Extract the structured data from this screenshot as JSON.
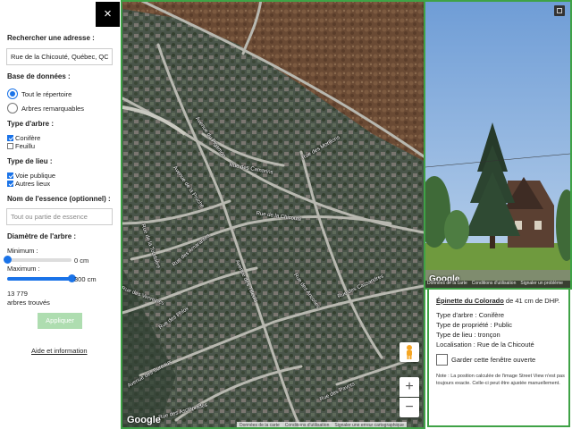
{
  "sidebar": {
    "close_label": "×",
    "search_title": "Rechercher une adresse :",
    "search_value": "Rue de la Chicouté, Québec, QC,",
    "database_title": "Base de données :",
    "database_options": [
      {
        "label": "Tout le répertoire",
        "selected": true
      },
      {
        "label": "Arbres remarquables",
        "selected": false
      }
    ],
    "tree_type_title": "Type d'arbre :",
    "tree_types": [
      {
        "label": "Conifère",
        "checked": true
      },
      {
        "label": "Feuillu",
        "checked": false
      }
    ],
    "place_type_title": "Type de lieu :",
    "place_types": [
      {
        "label": "Voie publique",
        "checked": true
      },
      {
        "label": "Autres lieux",
        "checked": true
      }
    ],
    "essence_title": "Nom de l'essence (optionnel) :",
    "essence_placeholder": "Tout ou partie de essence",
    "diameter_title": "Diamètre de l'arbre :",
    "min_label": "Minimum :",
    "min_value": "0 cm",
    "min_fraction": 0,
    "max_label": "Maximum :",
    "max_value": "300 cm",
    "max_fraction": 1,
    "count": "13 779",
    "count_label": "arbres trouvés",
    "apply_label": "Appliquer",
    "help_link": "Aide et information"
  },
  "map": {
    "streets": [
      "Rue des Camarins",
      "Rue de la Chicouté",
      "Avenue de la Pruche",
      "Rue des Morillons",
      "Avenue du Pigamon",
      "Rue de la Tourbière",
      "Rue des Amarantes",
      "Avenue des Tilleuls",
      "Rue des Verveines",
      "Rue des Ancolies",
      "Rue des Phlox",
      "Rue des Cassandres",
      "Avenue des Sureaux",
      "Rue des Asclépiades",
      "Rue des Pavots"
    ],
    "google_logo": "Google",
    "footer": [
      "Données de la carte",
      "Conditions d'utilisation",
      "Signaler une erreur cartographique"
    ],
    "zoom_in": "+",
    "zoom_out": "−"
  },
  "streetview": {
    "google_logo": "Google",
    "footer": [
      "Données de la carte",
      "Conditions d'utilisation",
      "Signaler un problème"
    ]
  },
  "info": {
    "species": "Épinette du Colorado",
    "diameter_text": " de 41 cm de DHP.",
    "rows": [
      "Type d'arbre : Conifère",
      "Type de propriété : Public",
      "Type de lieu : tronçon",
      "Localisation : Rue de la Chicouté"
    ],
    "keep_open_label": "Garder cette fenêtre ouverte",
    "note": "Note : La position calculée de l'image Street View n'est pas toujours exacte. Celle-ci peut être ajustée manuellement."
  },
  "colors": {
    "accent_blue": "#1a73e8",
    "panel_green": "#3fa246",
    "apply_disabled": "#aeddb0"
  }
}
